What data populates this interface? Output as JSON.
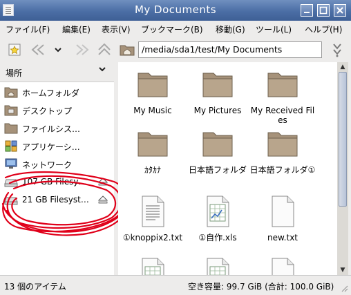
{
  "window": {
    "title": "My Documents"
  },
  "menu": [
    "ファイル(F)",
    "編集(E)",
    "表示(V)",
    "ブックマーク(B)",
    "移動(G)",
    "ツール(L)",
    "ヘルプ(H)"
  ],
  "location": {
    "path": "/media/sda1/test/My Documents"
  },
  "sidebar": {
    "header": "場所",
    "items": [
      {
        "label": "ホームフォルダ",
        "icon": "home-folder-icon"
      },
      {
        "label": "デスクトップ",
        "icon": "desktop-folder-icon"
      },
      {
        "label": "ファイルシス…",
        "icon": "filesystem-icon"
      },
      {
        "label": "アプリケーシ…",
        "icon": "applications-icon"
      },
      {
        "label": "ネットワーク",
        "icon": "network-icon"
      },
      {
        "label": "107 GB Filesy…",
        "icon": "drive-icon",
        "eject": true
      },
      {
        "label": "21 GB Filesyst…",
        "icon": "drive-icon",
        "eject": true
      }
    ]
  },
  "files": [
    {
      "name": "My Music",
      "type": "folder"
    },
    {
      "name": "My Pictures",
      "type": "folder"
    },
    {
      "name": "My Received Files",
      "type": "folder"
    },
    {
      "name": "ｶﾀｶﾅ",
      "type": "folder"
    },
    {
      "name": "日本語フォルダ",
      "type": "folder"
    },
    {
      "name": "日本語フォルダ①",
      "type": "folder"
    },
    {
      "name": "①knoppix2.txt",
      "type": "text"
    },
    {
      "name": "①自作.xls",
      "type": "spreadsheet"
    },
    {
      "name": "new.txt",
      "type": "text"
    },
    {
      "name": "",
      "type": "spreadsheet"
    },
    {
      "name": "",
      "type": "spreadsheet"
    },
    {
      "name": "",
      "type": "text"
    }
  ],
  "status": {
    "items": "13 個のアイテム",
    "space": "空き容量: 99.7 GiB (合計: 100.0 GiB)"
  },
  "colors": {
    "titlebar": "#4b6ea5",
    "annotation": "#e0001a",
    "folder": "#a6927a"
  }
}
